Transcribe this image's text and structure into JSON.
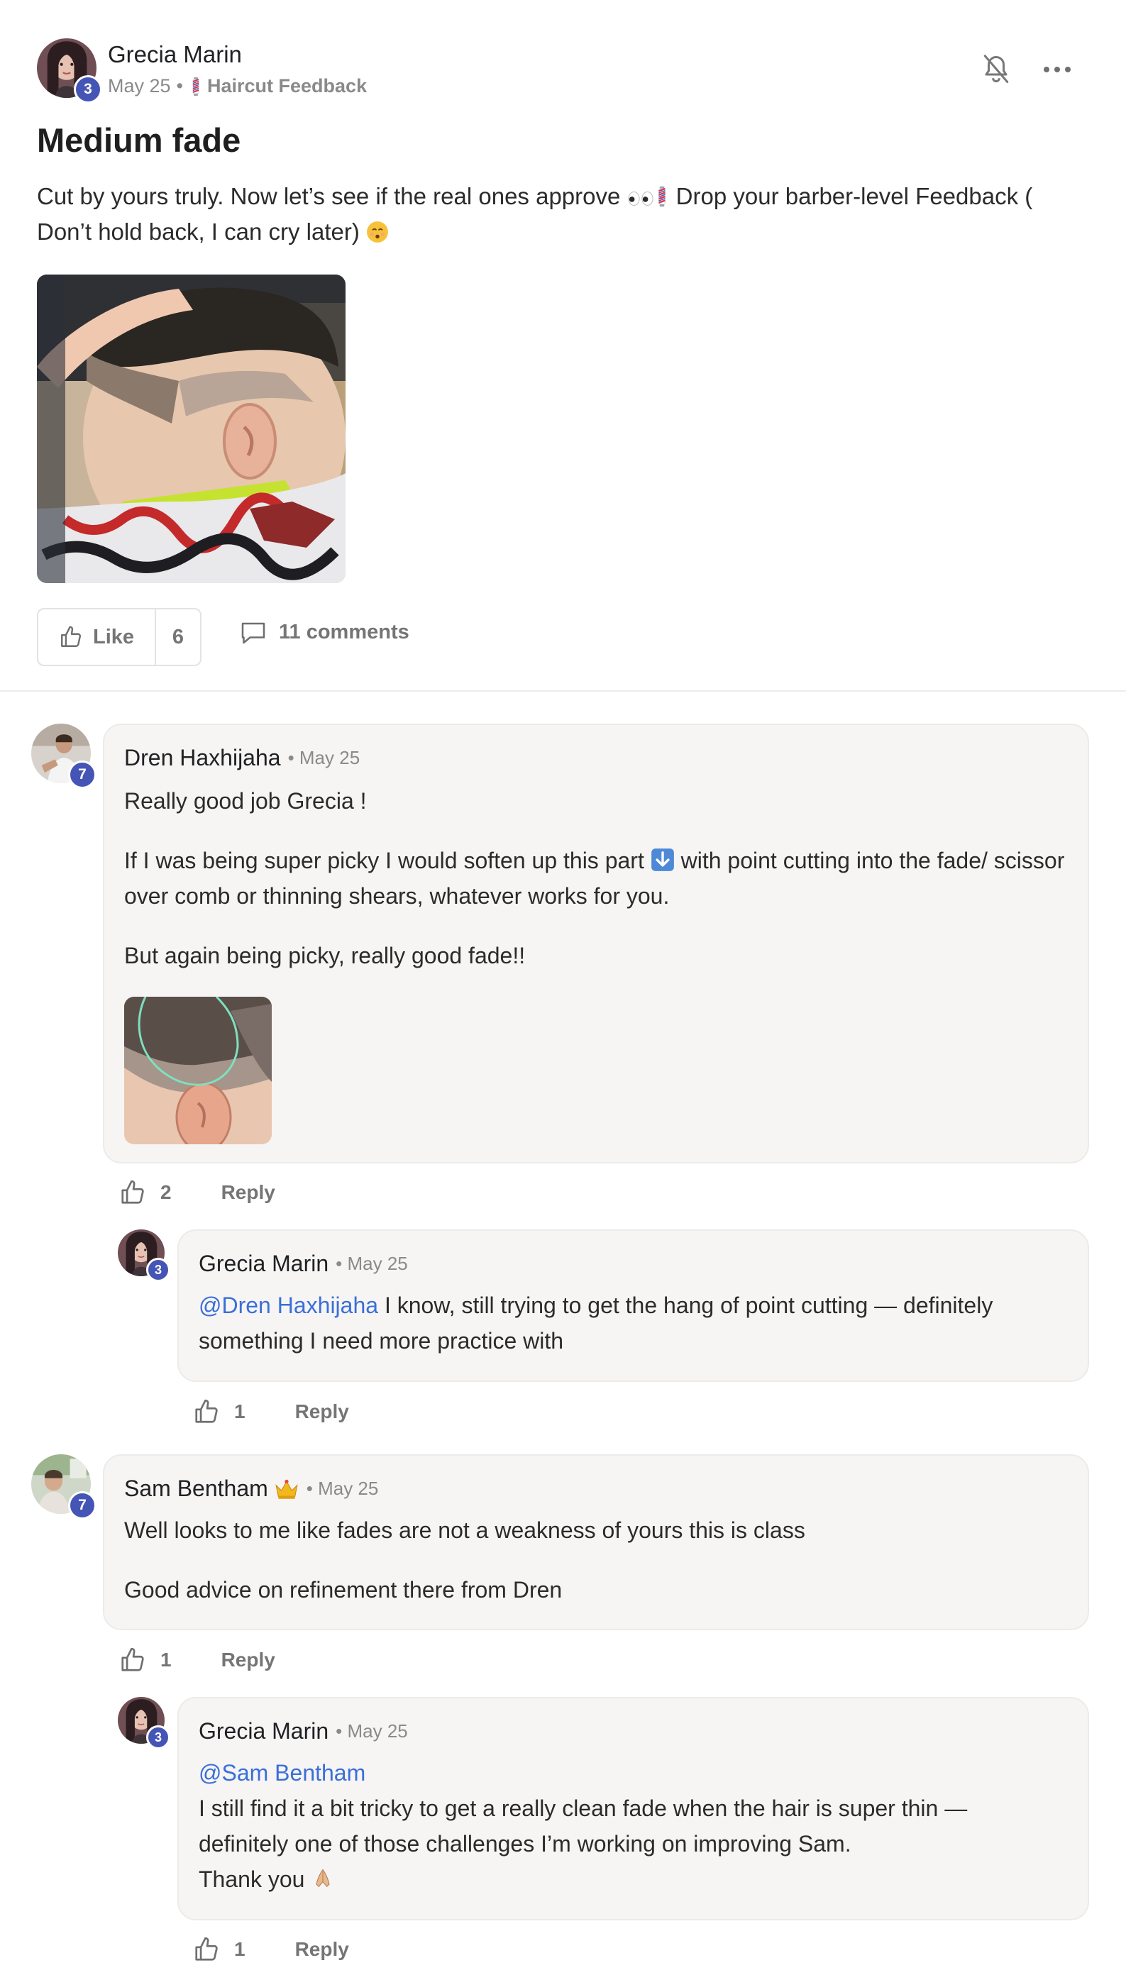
{
  "post": {
    "author": "Grecia Marin",
    "author_level": "3",
    "date": "May 25",
    "category_icon": "barber-pole",
    "category": "Haircut Feedback",
    "title": "Medium fade",
    "body_part1": "Cut by yours truly. Now let’s see if the real ones approve ",
    "body_part2": " Drop your barber-level Feedback ( Don’t hold back, I can cry later) ",
    "like_label": "Like",
    "like_count": "6",
    "comments_label": "11 comments"
  },
  "comments": [
    {
      "author": "Dren Haxhijaha",
      "level": "7",
      "date": "May 25",
      "p1": "Really good job Grecia !",
      "p2a": "If I was being super picky I would soften up this part ",
      "p2b": " with point cutting into the fade/ scissor over comb or thinning shears, whatever works for you.",
      "p3": "But again being picky, really good fade!!",
      "likes": "2",
      "reply_label": "Reply"
    },
    {
      "author": "Grecia Marin",
      "level": "3",
      "date": "May 25",
      "mention": "@Dren Haxhijaha",
      "text": " I know, still trying to get the hang of point cutting — definitely something I need more practice with",
      "likes": "1",
      "reply_label": "Reply"
    },
    {
      "author": "Sam Bentham",
      "level": "7",
      "date": "May 25",
      "p1": "Well looks to me like fades are not a weakness of yours this is class",
      "p2": "Good advice on refinement there from Dren",
      "likes": "1",
      "reply_label": "Reply"
    },
    {
      "author": "Grecia Marin",
      "level": "3",
      "date": "May 25",
      "mention": "@Sam Bentham",
      "line1": "I still find it a bit tricky to get a really clean fade when the hair is super thin —",
      "line2": "definitely one of those challenges I’m working on improving Sam.",
      "line3": "Thank you ",
      "likes": "1",
      "reply_label": "Reply"
    }
  ],
  "colors": {
    "level_badge": "#4555b5",
    "mention": "#3a6fd8",
    "bubble": "#f6f5f4"
  }
}
